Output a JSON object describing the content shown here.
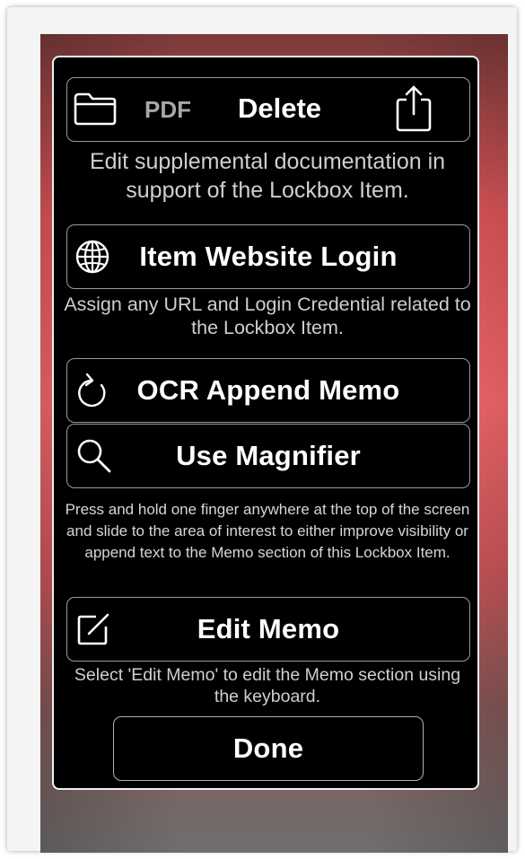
{
  "toolbar": {
    "pdf_label": "PDF",
    "delete_label": "Delete"
  },
  "supplemental_desc": "Edit supplemental documentation in support of the Lockbox Item.",
  "website_login": {
    "label": "Item Website Login",
    "desc": "Assign any URL and Login Credential related to the Lockbox Item."
  },
  "ocr": {
    "label": "OCR Append Memo"
  },
  "magnifier": {
    "label": "Use Magnifier",
    "desc": "Press and hold one finger anywhere at the top of the screen and slide to the area of interest to either improve visibility or append text to the Memo section of this Lockbox Item."
  },
  "edit_memo": {
    "label": "Edit Memo",
    "desc": "Select 'Edit Memo' to edit the Memo section using the keyboard."
  },
  "done_label": "Done",
  "colors": {
    "panel_background": "#000000",
    "button_border": "#9a9a9a",
    "text_primary": "#ffffff",
    "text_secondary": "#cfcfcf",
    "backdrop_red": "#ff6e72"
  },
  "icons": [
    "folder-icon",
    "share-icon",
    "globe-icon",
    "refresh-icon",
    "magnifier-icon",
    "edit-icon"
  ]
}
